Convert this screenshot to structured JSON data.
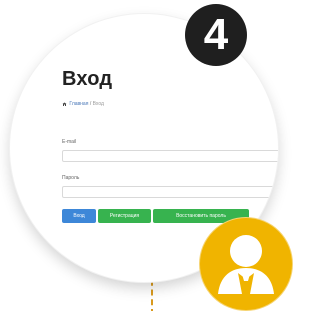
{
  "step": {
    "number": "4"
  },
  "login_form": {
    "title": "Вход",
    "breadcrumb": {
      "home": "Главная",
      "separator": " / ",
      "current": "Вход"
    },
    "fields": {
      "email_label": "E-mail",
      "password_label": "Пароль",
      "email_value": "",
      "password_value": ""
    },
    "buttons": {
      "login": "Вход",
      "register": "Регистрация",
      "restore_password": "Восстановить пароль"
    }
  },
  "icons": {
    "home": "home-icon",
    "user": "user-icon"
  },
  "colors": {
    "step_badge": "#1f1f1f",
    "user_badge": "#f0b400",
    "login_button": "#3d87d8",
    "secondary_buttons": "#37b34f",
    "connector": "#d99a1e"
  }
}
